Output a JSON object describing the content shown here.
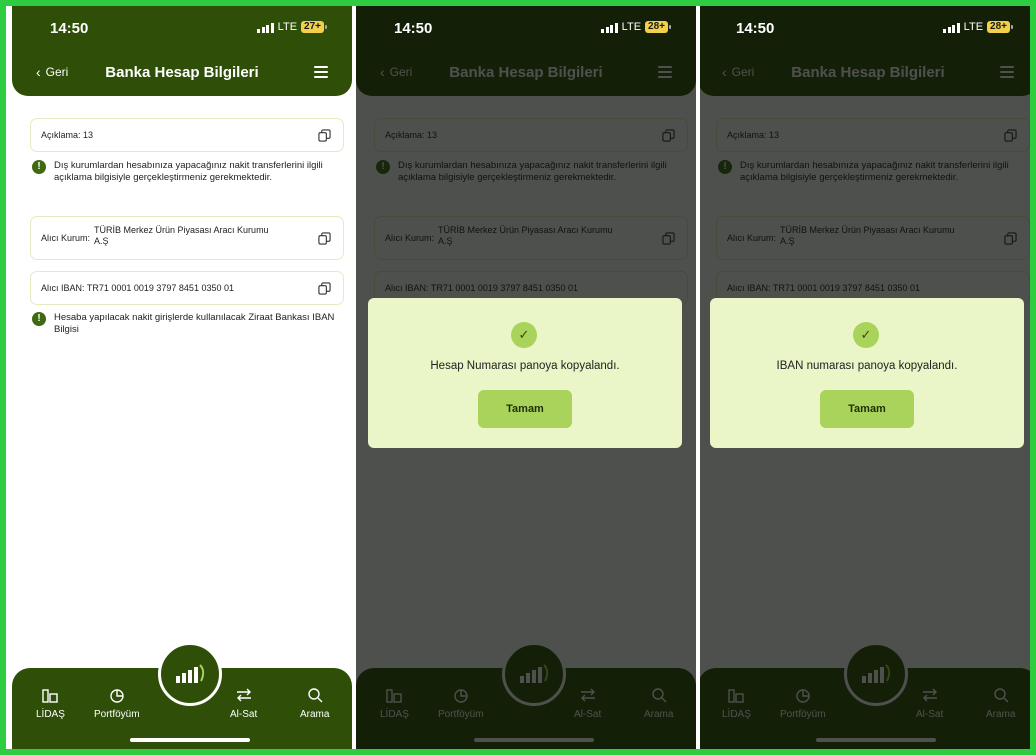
{
  "status": {
    "time": "14:50",
    "network": "LTE",
    "battery_s1": "27+",
    "battery_s2": "28+",
    "battery_s3": "28+"
  },
  "header": {
    "back_label": "Geri",
    "title": "Banka Hesap Bilgileri"
  },
  "content": {
    "aciklama": "Açıklama: 13",
    "warning1": "Dış kurumlardan hesabınıza yapacağınız nakit transferlerini ilgili açıklama bilgisiyle gerçekleştirmeniz gerekmektedir.",
    "alici_kurum_label": "Alıcı Kurum:",
    "alici_kurum_value": "TÜRİB Merkez Ürün Piyasası Aracı Kurumu A.Ş",
    "alici_iban": "Alıcı IBAN:  TR71 0001 0019 3797 8451 0350 01",
    "warning2": "Hesaba yapılacak nakit girişlerde kullanılacak Ziraat Bankası IBAN Bilgisi",
    "info_icon": "!"
  },
  "nav": {
    "items": [
      "LİDAŞ",
      "Portföyüm",
      "Al-Sat",
      "Arama"
    ]
  },
  "dialogs": {
    "hesap": {
      "message": "Hesap Numarası panoya kopyalandı.",
      "button": "Tamam"
    },
    "iban": {
      "message": "IBAN numarası panoya kopyalandı.",
      "button": "Tamam"
    }
  },
  "colors": {
    "brand": "#2f4f08",
    "accent": "#a9d35a",
    "card_border": "#e3ecbf",
    "dialog_bg": "#eaf5c8"
  }
}
